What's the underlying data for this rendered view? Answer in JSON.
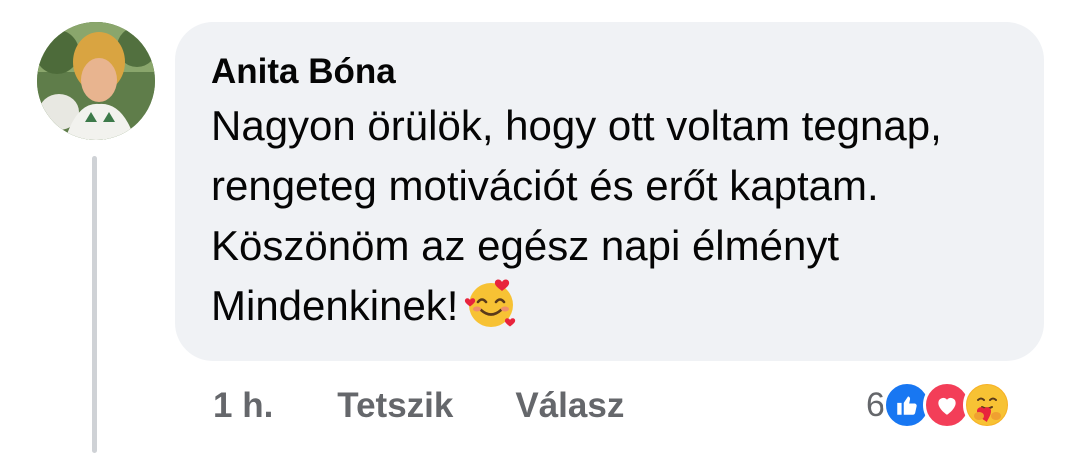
{
  "comment": {
    "author": "Anita Bóna",
    "text": "Nagyon örülök, hogy ott voltam tegnap, rengeteg motivációt és erőt kaptam. Köszönöm az egész napi élményt Mindenkinek!",
    "inline_emoji": "smiling-face-with-hearts-icon"
  },
  "actions": {
    "time": "1 h.",
    "like_label": "Tetszik",
    "reply_label": "Válasz"
  },
  "reactions": {
    "count": "6",
    "types": [
      "like-icon",
      "love-icon",
      "care-icon"
    ]
  },
  "colors": {
    "bubble_bg": "#f0f2f5",
    "text": "#050505",
    "secondary_text": "#65676b",
    "like_blue": "#1877f2",
    "love_red": "#f33e58",
    "care_yellow": "#f7b125"
  }
}
